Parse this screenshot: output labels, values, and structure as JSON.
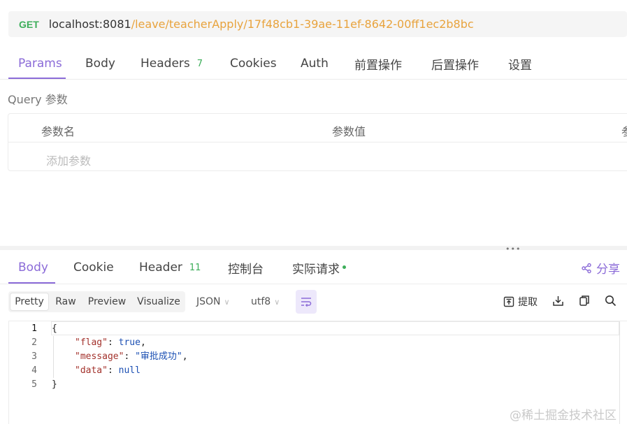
{
  "request": {
    "method": "GET",
    "host": "localhost:8081",
    "path": "/leave/teacherApply/17f48cb1-39ae-11ef-8642-00ff1ec2b8bc"
  },
  "request_tabs": [
    {
      "label": "Params",
      "active": true
    },
    {
      "label": "Body"
    },
    {
      "label": "Headers",
      "count": "7"
    },
    {
      "label": "Cookies"
    },
    {
      "label": "Auth"
    },
    {
      "label": "前置操作"
    },
    {
      "label": "后置操作"
    },
    {
      "label": "设置"
    }
  ],
  "query": {
    "section_label": "Query 参数",
    "columns": [
      "参数名",
      "参数值",
      "参"
    ],
    "add_placeholder": "添加参数"
  },
  "response_tabs": [
    {
      "label": "Body",
      "active": true
    },
    {
      "label": "Cookie"
    },
    {
      "label": "Header",
      "count": "11"
    },
    {
      "label": "控制台"
    },
    {
      "label": "实际请求",
      "dot": true
    }
  ],
  "share_label": "分享",
  "viewer": {
    "modes": [
      "Pretty",
      "Raw",
      "Preview",
      "Visualize"
    ],
    "active_mode": "Pretty",
    "format": "JSON",
    "encoding": "utf8",
    "extract_label": "提取"
  },
  "code": {
    "line_numbers": [
      "1",
      "2",
      "3",
      "4",
      "5"
    ],
    "open_brace": "{",
    "close_brace": "}",
    "fields": [
      {
        "key": "\"flag\"",
        "value": "true",
        "comma": ","
      },
      {
        "key": "\"message\"",
        "value": "\"审批成功\"",
        "comma": ","
      },
      {
        "key": "\"data\"",
        "value": "null",
        "comma": ""
      }
    ]
  },
  "watermark": "@稀土掘金技术社区",
  "colors": {
    "accent": "#8b6bd8",
    "method_get": "#3dae5a",
    "url_path": "#e8a33d",
    "json_key": "#a3322c",
    "json_value": "#1b4fb3"
  }
}
